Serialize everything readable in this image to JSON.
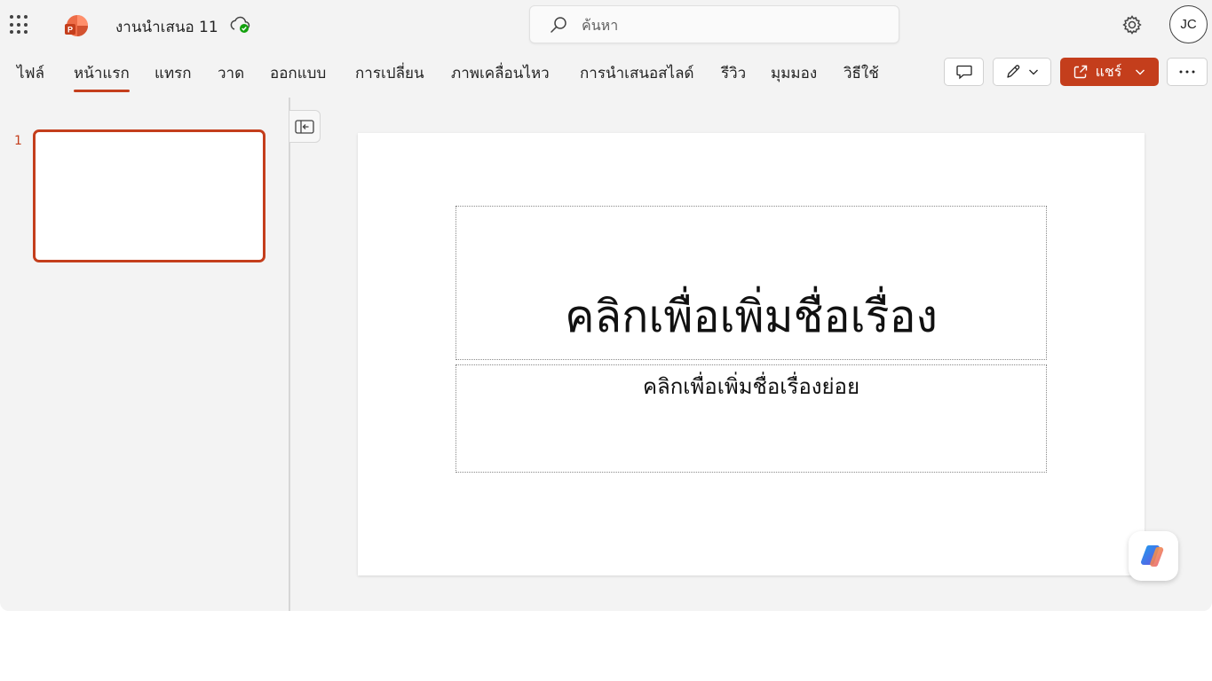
{
  "app": {
    "document_title": "งานนำเสนอ 11",
    "icons": {
      "app_launcher": "waffle-icon",
      "logo": "powerpoint-logo-icon",
      "save_status": "cloud-saved-icon",
      "settings": "gear-icon"
    }
  },
  "search": {
    "placeholder": "ค้นหา"
  },
  "user": {
    "initials": "JC"
  },
  "ribbon": {
    "tabs": [
      {
        "label": "ไฟล์",
        "active": false
      },
      {
        "label": "หน้าแรก",
        "active": true
      },
      {
        "label": "แทรก",
        "active": false
      },
      {
        "label": "วาด",
        "active": false
      },
      {
        "label": "ออกแบบ",
        "active": false
      },
      {
        "label": "การเปลี่ยน",
        "active": false
      },
      {
        "label": "ภาพเคลื่อนไหว",
        "active": false
      },
      {
        "label": "การนำเสนอสไลด์",
        "active": false
      },
      {
        "label": "รีวิว",
        "active": false
      },
      {
        "label": "มุมมอง",
        "active": false
      },
      {
        "label": "วิธีใช้",
        "active": false
      }
    ],
    "share_label": "แชร์"
  },
  "thumbnails": {
    "slides": [
      {
        "number": "1",
        "selected": true
      }
    ]
  },
  "slide": {
    "title_placeholder": "คลิกเพื่อเพิ่มชื่อเรื่อง",
    "subtitle_placeholder": "คลิกเพื่อเพิ่มชื่อเรื่องย่อย"
  },
  "colors": {
    "accent": "#c43e1c",
    "background": "#f3f3f3"
  }
}
